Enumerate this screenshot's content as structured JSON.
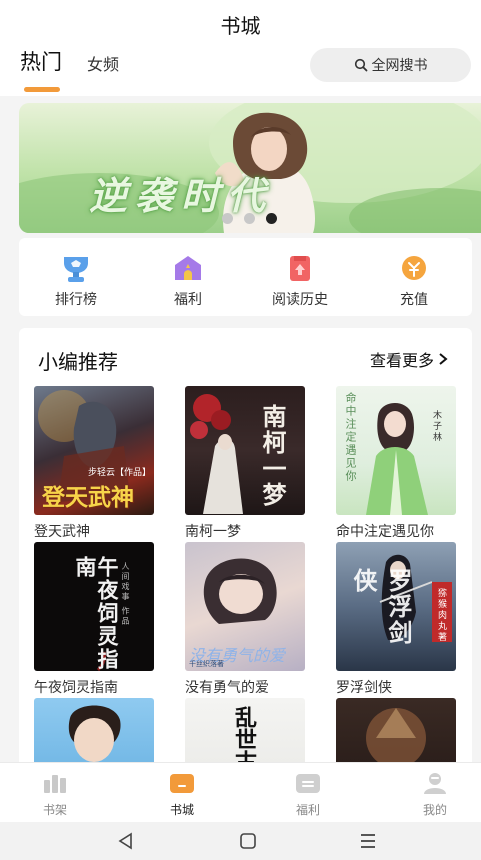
{
  "header": {
    "title": "书城",
    "tabs": [
      {
        "label": "热门",
        "active": true
      },
      {
        "label": "女频",
        "active": false
      }
    ],
    "search_label": "全网搜书",
    "accent_color": "#f29a3a"
  },
  "banner": {
    "title": "逆袭时代",
    "carousel_pages": 3,
    "active_page": 3
  },
  "shortcuts": [
    {
      "label": "排行榜",
      "icon": "trophy-icon"
    },
    {
      "label": "福利",
      "icon": "gift-house-icon"
    },
    {
      "label": "阅读历史",
      "icon": "history-icon"
    },
    {
      "label": "充值",
      "icon": "coin-icon"
    }
  ],
  "recommend": {
    "title": "小编推荐",
    "more_label": "查看更多",
    "books": [
      {
        "title": "登天武神",
        "cover_text": "登天武神",
        "cover_author": "步轻云【作品】"
      },
      {
        "title": "南柯一梦",
        "cover_text": "南柯一梦"
      },
      {
        "title": "命中注定遇见你",
        "cover_text": "命中注定遇见你",
        "cover_author": "木子林"
      },
      {
        "title": "午夜饲灵指南",
        "cover_text": "午夜饲灵指南",
        "cover_author": "人间戏事 作品"
      },
      {
        "title": "没有勇气的爱",
        "cover_text": "没有勇气的爱",
        "cover_author": "千丝织落著"
      },
      {
        "title": "罗浮剑侠",
        "cover_text": "罗浮剑侠",
        "cover_author": "猕猴肉丸著"
      },
      {
        "title": "",
        "cover_text": ""
      },
      {
        "title": "",
        "cover_text": "乱世古城"
      },
      {
        "title": "",
        "cover_text": ""
      }
    ]
  },
  "bottom_nav": [
    {
      "label": "书架",
      "icon": "bookshelf-icon",
      "active": false
    },
    {
      "label": "书城",
      "icon": "bookstore-icon",
      "active": true
    },
    {
      "label": "福利",
      "icon": "welfare-icon",
      "active": false
    },
    {
      "label": "我的",
      "icon": "profile-icon",
      "active": false
    }
  ],
  "system_nav": [
    "back-icon",
    "home-icon",
    "recents-icon"
  ]
}
